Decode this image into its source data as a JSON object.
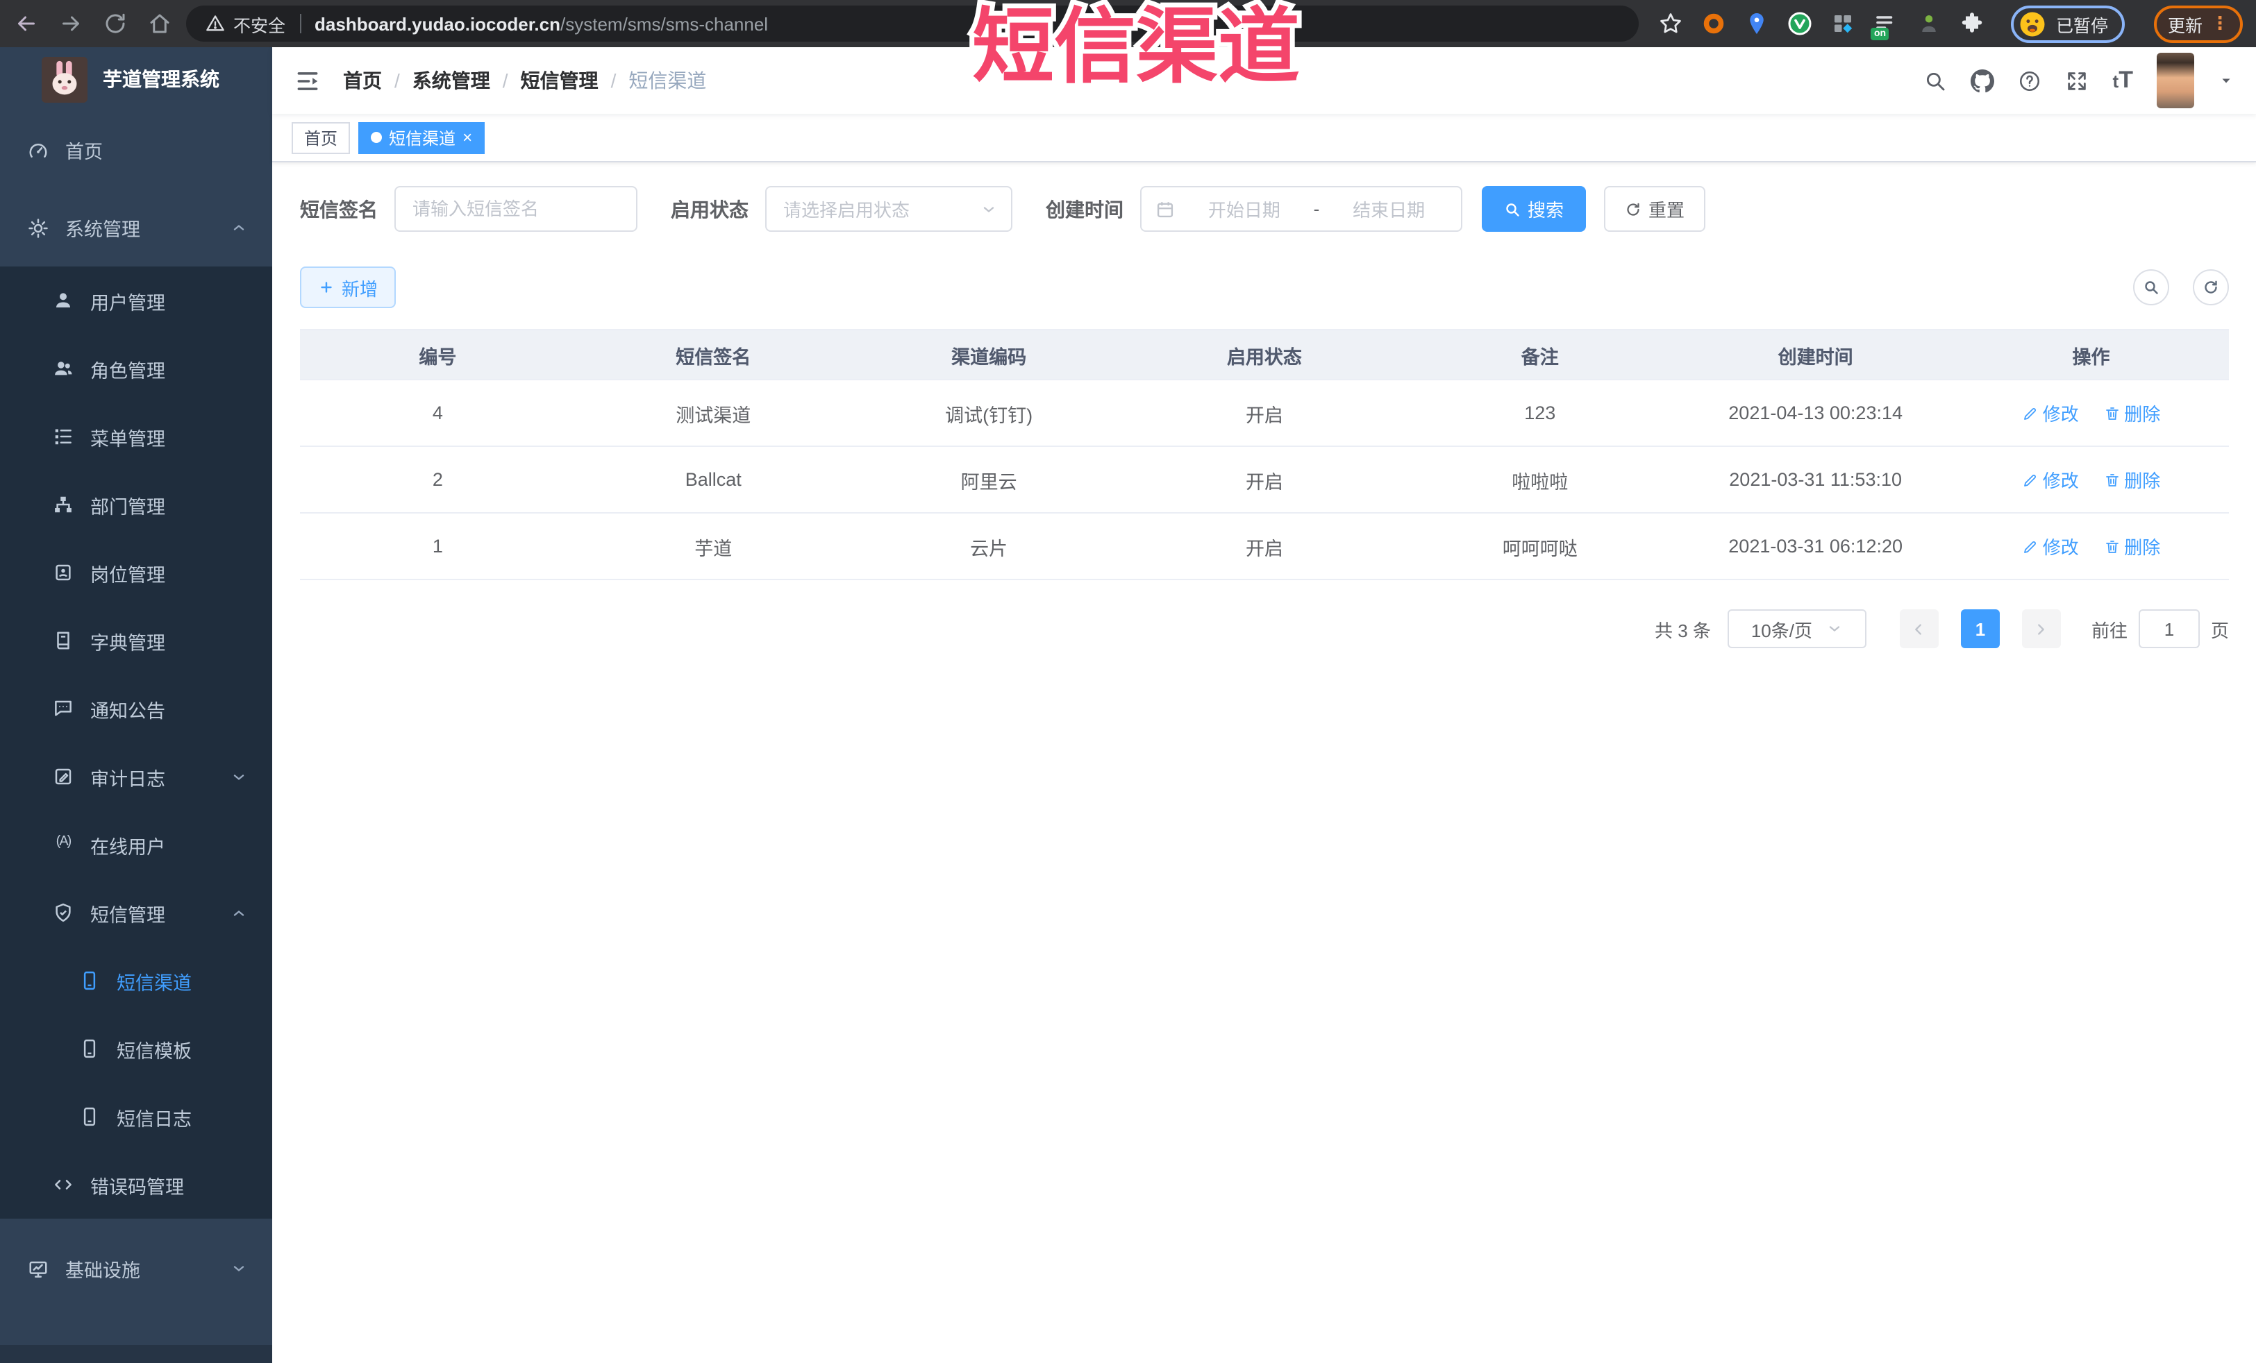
{
  "overlay": {
    "title": "短信渠道"
  },
  "browser": {
    "not_secure_label": "不安全",
    "url_host": "dashboard.yudao.iocoder.cn",
    "url_path": "/system/sms/sms-channel",
    "ext_on_badge": "on",
    "profile_status": "已暂停",
    "update_label": "更新"
  },
  "sidebar": {
    "title": "芋道管理系统",
    "items": [
      {
        "label": "首页"
      },
      {
        "label": "系统管理"
      },
      {
        "label": "用户管理"
      },
      {
        "label": "角色管理"
      },
      {
        "label": "菜单管理"
      },
      {
        "label": "部门管理"
      },
      {
        "label": "岗位管理"
      },
      {
        "label": "字典管理"
      },
      {
        "label": "通知公告"
      },
      {
        "label": "审计日志"
      },
      {
        "label": "在线用户"
      },
      {
        "label": "短信管理"
      },
      {
        "label": "短信渠道"
      },
      {
        "label": "短信模板"
      },
      {
        "label": "短信日志"
      },
      {
        "label": "错误码管理"
      },
      {
        "label": "基础设施"
      }
    ]
  },
  "navbar": {
    "breadcrumb": [
      "首页",
      "系统管理",
      "短信管理",
      "短信渠道"
    ]
  },
  "tags": [
    {
      "label": "首页"
    },
    {
      "label": "短信渠道"
    }
  ],
  "filters": {
    "signature_label": "短信签名",
    "signature_placeholder": "请输入短信签名",
    "status_label": "启用状态",
    "status_placeholder": "请选择启用状态",
    "time_label": "创建时间",
    "start_placeholder": "开始日期",
    "range_separator": "-",
    "end_placeholder": "结束日期",
    "search_label": "搜索",
    "reset_label": "重置"
  },
  "toolbar": {
    "add_label": "新增"
  },
  "table": {
    "headers": [
      "编号",
      "短信签名",
      "渠道编码",
      "启用状态",
      "备注",
      "创建时间",
      "操作"
    ],
    "edit_label": "修改",
    "delete_label": "删除",
    "rows": [
      {
        "id": "4",
        "signature": "测试渠道",
        "code": "调试(钉钉)",
        "status": "开启",
        "remark": "123",
        "created": "2021-04-13 00:23:14"
      },
      {
        "id": "2",
        "signature": "Ballcat",
        "code": "阿里云",
        "status": "开启",
        "remark": "啦啦啦",
        "created": "2021-03-31 11:53:10"
      },
      {
        "id": "1",
        "signature": "芋道",
        "code": "云片",
        "status": "开启",
        "remark": "呵呵呵哒",
        "created": "2021-03-31 06:12:20"
      }
    ]
  },
  "pagination": {
    "total_label": "共 3 条",
    "page_size_label": "10条/页",
    "current_page": "1",
    "goto_label": "前往",
    "goto_value": "1",
    "goto_suffix_label": "页"
  }
}
